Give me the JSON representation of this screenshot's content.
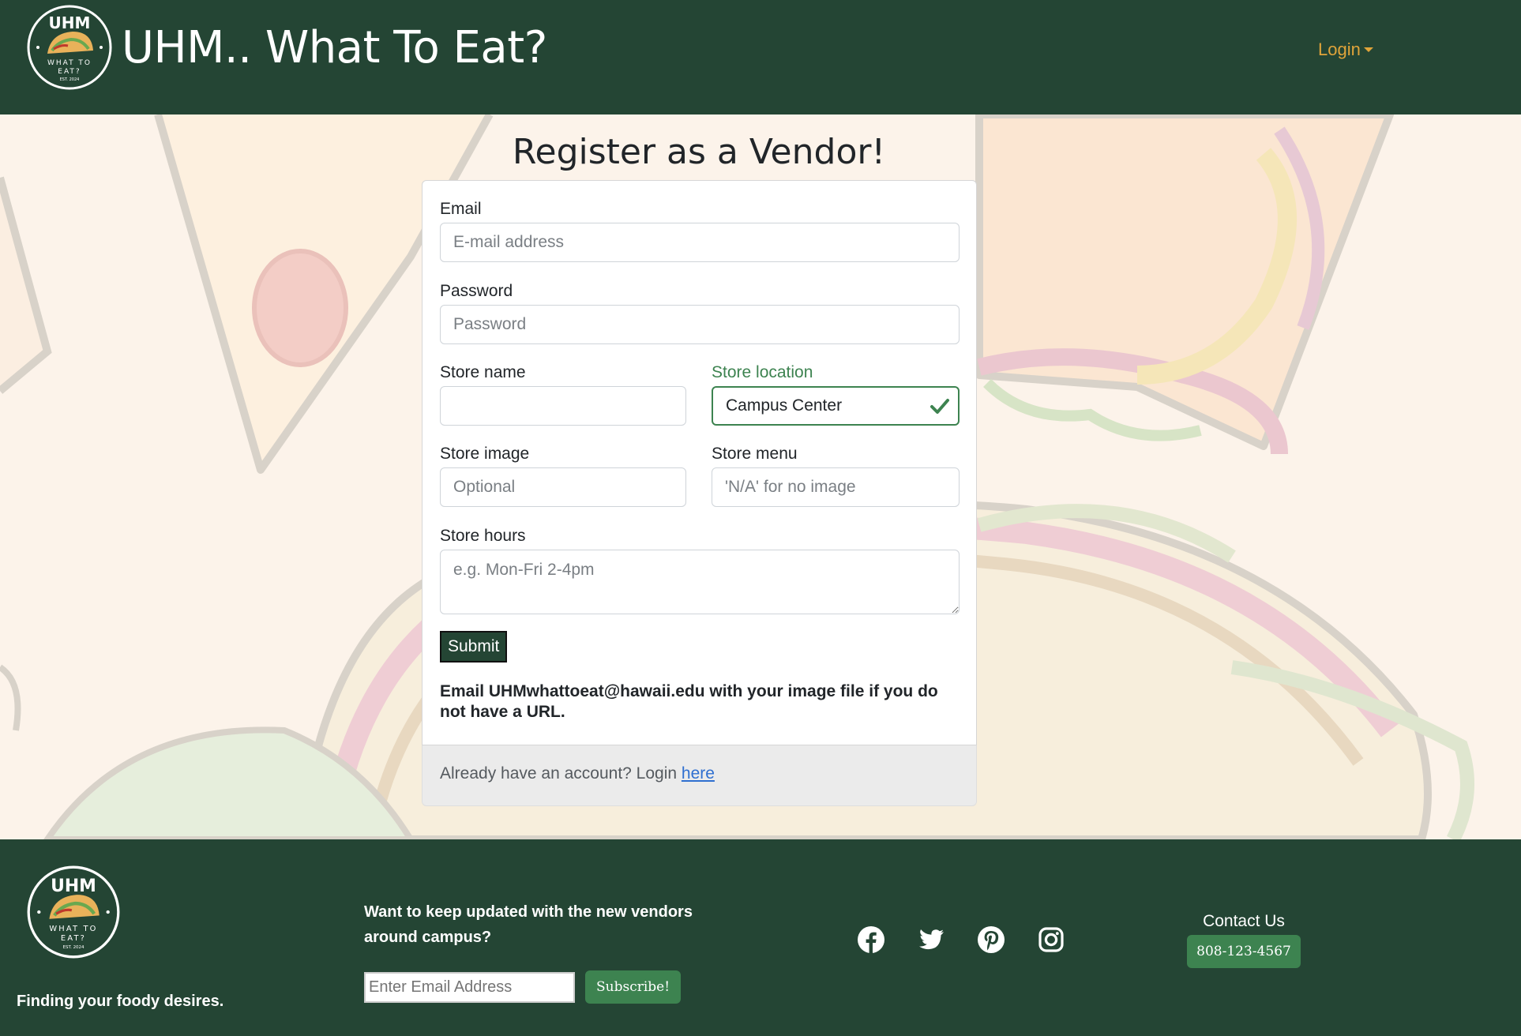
{
  "app": {
    "title": "UHM.. What To Eat?",
    "login_label": "Login"
  },
  "logo": {
    "top_text": "UHM",
    "bottom_text_1": "WHAT TO",
    "bottom_text_2": "EAT?",
    "est_text": "EST. 2024"
  },
  "page": {
    "title": "Register as a Vendor!"
  },
  "form": {
    "email": {
      "label": "Email",
      "placeholder": "E-mail address",
      "value": ""
    },
    "password": {
      "label": "Password",
      "placeholder": "Password",
      "value": ""
    },
    "store_name": {
      "label": "Store name",
      "placeholder": "",
      "value": ""
    },
    "store_location": {
      "label": "Store location",
      "value": "Campus Center",
      "status": "valid"
    },
    "store_image": {
      "label": "Store image",
      "placeholder": "Optional",
      "value": ""
    },
    "store_menu": {
      "label": "Store menu",
      "placeholder": "'N/A' for no image",
      "value": ""
    },
    "store_hours": {
      "label": "Store hours",
      "placeholder": "e.g. Mon-Fri 2-4pm",
      "value": ""
    },
    "submit_label": "Submit",
    "info_text": "Email UHMwhattoeat@hawaii.edu with your image file if you do not have a URL."
  },
  "card_footer": {
    "text": "Already have an account? Login ",
    "link_label": "here"
  },
  "footer": {
    "tagline": "Finding your foody desires.",
    "newsletter_text": "Want to keep updated with the new vendors around campus?",
    "email_placeholder": "Enter Email Address",
    "subscribe_label": "Subscribe!",
    "social_icons": [
      "facebook-icon",
      "twitter-icon",
      "pinterest-icon",
      "instagram-icon"
    ],
    "contact_title": "Contact Us",
    "phone": "808-123-4567"
  },
  "colors": {
    "brand_green": "#244534",
    "accent_green": "#3d8350",
    "login_gold": "#e0a43a",
    "page_bg": "#fcf3ea"
  }
}
